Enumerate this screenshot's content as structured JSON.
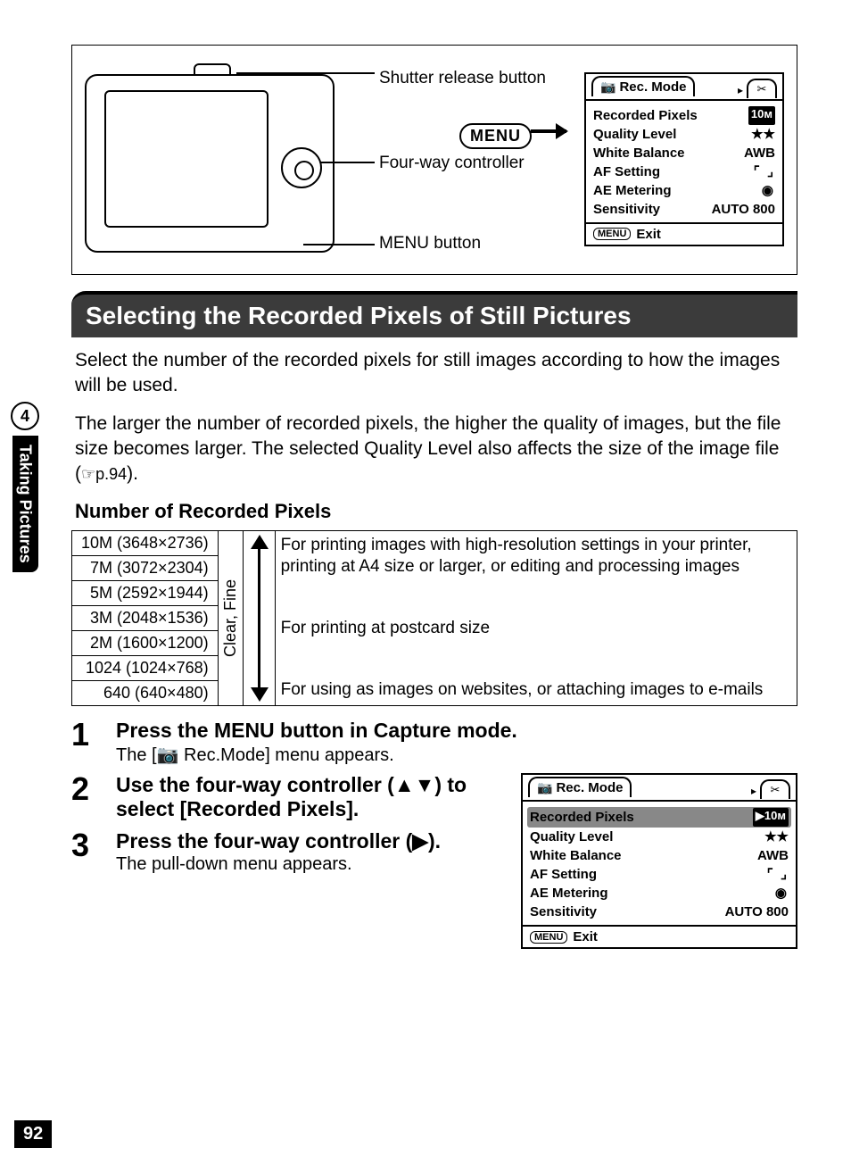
{
  "page_number": "92",
  "side_tab": {
    "number": "4",
    "label": "Taking Pictures"
  },
  "diagram_labels": {
    "shutter": "Shutter release button",
    "fourway": "Four-way controller",
    "menu_button": "MENU button",
    "menu_btn_text": "MENU"
  },
  "lcd_top": {
    "tab_title": "Rec. Mode",
    "tool_icon": "✂",
    "rows": [
      {
        "label": "Recorded Pixels",
        "value": "10ᴍ",
        "bg": true
      },
      {
        "label": "Quality Level",
        "value": "★★"
      },
      {
        "label": "White Balance",
        "value": "AWB"
      },
      {
        "label": "AF Setting",
        "value": "⌜ ⌟",
        "icon": true
      },
      {
        "label": "AE Metering",
        "value": "◉",
        "icon": true
      },
      {
        "label": "Sensitivity",
        "value": "AUTO 800"
      }
    ],
    "foot_menu": "MENU",
    "foot_label": "Exit"
  },
  "section_title": "Selecting the Recorded Pixels of Still Pictures",
  "body1": "Select the number of the recorded pixels for still images according to how the images will be used.",
  "body2_a": "The larger the number of recorded pixels, the higher the quality of images, but the file size becomes larger. The selected Quality Level also affects the size of the image file (",
  "body2_ref": "☞p.94",
  "body2_b": ").",
  "sub_heading": "Number of Recorded Pixels",
  "pixel_table": {
    "rows": [
      "10M (3648×2736)",
      "7M (3072×2304)",
      "5M (2592×1944)",
      "3M (2048×1536)",
      "2M (1600×1200)",
      "1024 (1024×768)",
      "640 (640×480)"
    ],
    "scale_label": "Clear, Fine",
    "desc_top": "For printing images with high-resolution settings in your printer, printing at A4 size or larger, or editing and processing images",
    "desc_mid": "For printing at postcard size",
    "desc_bot": "For using as images on websites, or attaching images to e-mails"
  },
  "steps": {
    "s1_title": "Press the MENU button in Capture mode.",
    "s1_sub_a": "The [",
    "s1_sub_icon": "📷",
    "s1_sub_b": " Rec.Mode] menu appears.",
    "s2_title": "Use the four-way controller (▲▼) to select [Recorded Pixels].",
    "s3_title": "Press the four-way controller (▶).",
    "s3_sub": "The pull-down menu appears."
  },
  "lcd_bottom": {
    "tab_title": "Rec. Mode",
    "tool_icon": "✂",
    "rows": [
      {
        "label": "Recorded Pixels",
        "value": "▶10ᴍ",
        "sel": true,
        "bg": true
      },
      {
        "label": "Quality Level",
        "value": "★★"
      },
      {
        "label": "White Balance",
        "value": "AWB"
      },
      {
        "label": "AF Setting",
        "value": "⌜ ⌟",
        "icon": true
      },
      {
        "label": "AE Metering",
        "value": "◉",
        "icon": true
      },
      {
        "label": "Sensitivity",
        "value": "AUTO 800"
      }
    ],
    "foot_menu": "MENU",
    "foot_label": "Exit"
  }
}
